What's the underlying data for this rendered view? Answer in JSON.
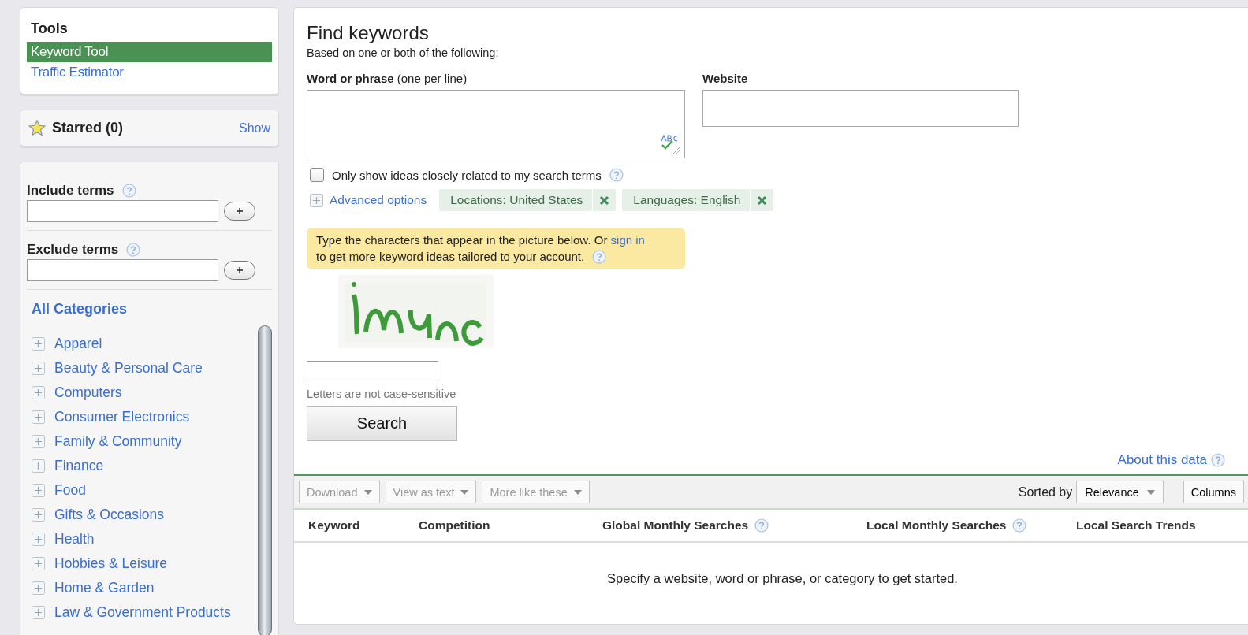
{
  "tools": {
    "title": "Tools",
    "items": [
      {
        "label": "Keyword Tool",
        "selected": true
      },
      {
        "label": "Traffic Estimator",
        "selected": false
      }
    ]
  },
  "starred": {
    "label": "Starred (0)",
    "action": "Show"
  },
  "filters": [
    {
      "label": "Include terms"
    },
    {
      "label": "Exclude terms"
    }
  ],
  "categories": {
    "title": "All Categories",
    "items": [
      "Apparel",
      "Beauty & Personal Care",
      "Computers",
      "Consumer Electronics",
      "Family & Community",
      "Finance",
      "Food",
      "Gifts & Occasions",
      "Health",
      "Hobbies & Leisure",
      "Home & Garden",
      "Law & Government Products"
    ]
  },
  "main": {
    "title": "Find keywords",
    "subtitle": "Based on one or both of the following:",
    "phrase_label": "**Word or phrase** (one per line)",
    "website_label": "Website",
    "closely_related": {
      "label": "Only show ideas closely related to my search terms",
      "checked": false
    },
    "advanced_options": "Advanced options",
    "chips": [
      {
        "label": "Locations: United States"
      },
      {
        "label": "Languages: English"
      }
    ],
    "notice": {
      "text": "Type the characters that appear in the picture below. Or",
      "link": "sign in",
      "text_after": "to get more keyword ideas tailored to your account."
    },
    "captcha_hint": "Letters are not case-sensitive",
    "search_button": "Search",
    "about_link": "About this data"
  },
  "toolbar": {
    "buttons": [
      {
        "label": "Download",
        "disabled": true
      },
      {
        "label": "View as text",
        "disabled": true
      },
      {
        "label": "More like these",
        "disabled": true
      }
    ],
    "sorted_by": "Sorted by",
    "sort_value": "Relevance",
    "columns_button": "Columns"
  },
  "table": {
    "columns": [
      {
        "label": "Keyword",
        "help": false
      },
      {
        "label": "Competition",
        "help": false
      },
      {
        "label": "Global Monthly Searches",
        "help": true
      },
      {
        "label": "Local Monthly Searches",
        "help": true
      },
      {
        "label": "Local Search Trends",
        "help": false
      }
    ],
    "empty_message": "Specify a website, word or phrase, or category to get started."
  }
}
